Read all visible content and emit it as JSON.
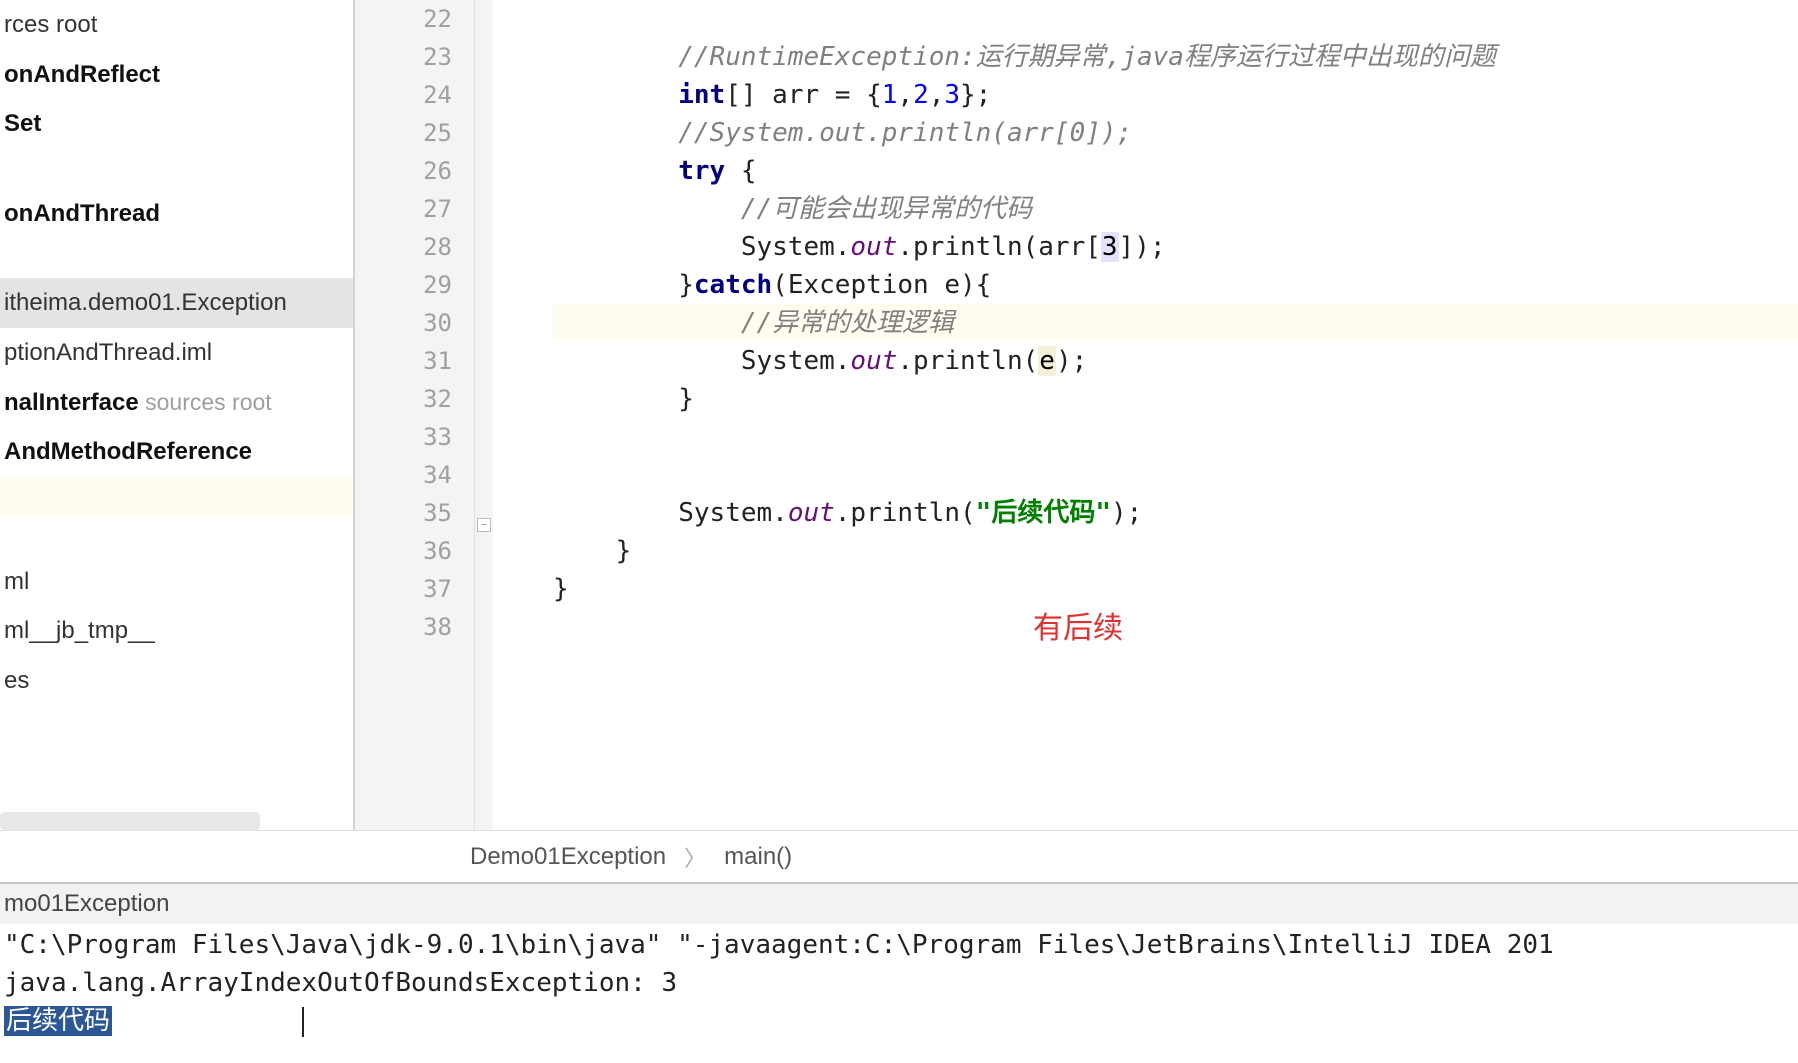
{
  "sidebar": {
    "items": [
      {
        "label": "rces root",
        "bold": false,
        "suffix": ""
      },
      {
        "label": "onAndReflect",
        "bold": true
      },
      {
        "label": "Set",
        "bold": true
      },
      {
        "label": "",
        "blank": true
      },
      {
        "label": "onAndThread",
        "bold": true
      },
      {
        "label": "",
        "blank": true
      },
      {
        "label": "itheima.demo01.Exception",
        "bold": false,
        "selected": true
      },
      {
        "label": "ptionAndThread.iml",
        "bold": false
      },
      {
        "label": "nalInterface",
        "bold": true,
        "suffix": "sources root"
      },
      {
        "label": "AndMethodReference",
        "bold": true
      },
      {
        "label": "",
        "blank": true,
        "highlight": true
      },
      {
        "label": "",
        "blank": true
      },
      {
        "label": "ml",
        "bold": false
      },
      {
        "label": "ml__jb_tmp__",
        "bold": false
      },
      {
        "label": "es",
        "bold": false
      }
    ]
  },
  "gutter": {
    "start": 22,
    "end": 38
  },
  "code": {
    "lines": [
      {
        "n": 22,
        "segments": []
      },
      {
        "n": 23,
        "indent": 2,
        "segments": [
          {
            "c": "kw-comment",
            "t": "//RuntimeException:运行期异常,java程序运行过程中出现的问题"
          }
        ]
      },
      {
        "n": 24,
        "indent": 2,
        "segments": [
          {
            "c": "kw-type",
            "t": "int"
          },
          {
            "c": "kw-plain",
            "t": "[] arr = {"
          },
          {
            "c": "kw-number",
            "t": "1"
          },
          {
            "c": "kw-plain",
            "t": ","
          },
          {
            "c": "kw-number",
            "t": "2"
          },
          {
            "c": "kw-plain",
            "t": ","
          },
          {
            "c": "kw-number",
            "t": "3"
          },
          {
            "c": "kw-plain",
            "t": "};"
          }
        ]
      },
      {
        "n": 25,
        "indent": 2,
        "segments": [
          {
            "c": "kw-comment",
            "t": "//System.out.println(arr[0]);"
          }
        ]
      },
      {
        "n": 26,
        "indent": 2,
        "segments": [
          {
            "c": "kw-keyword",
            "t": "try"
          },
          {
            "c": "kw-plain",
            "t": " {"
          }
        ]
      },
      {
        "n": 27,
        "indent": 3,
        "segments": [
          {
            "c": "kw-comment",
            "t": "//可能会出现异常的代码"
          }
        ]
      },
      {
        "n": 28,
        "indent": 3,
        "segments": [
          {
            "c": "kw-plain",
            "t": "System."
          },
          {
            "c": "kw-field",
            "t": "out"
          },
          {
            "c": "kw-plain",
            "t": ".println(arr["
          },
          {
            "c": "kw-index-hl",
            "t": "3"
          },
          {
            "c": "kw-plain",
            "t": "]);"
          }
        ]
      },
      {
        "n": 29,
        "indent": 2,
        "segments": [
          {
            "c": "kw-plain",
            "t": "}"
          },
          {
            "c": "kw-keyword",
            "t": "catch"
          },
          {
            "c": "kw-plain",
            "t": "(Exception e){"
          }
        ]
      },
      {
        "n": 30,
        "indent": 3,
        "hl": true,
        "segments": [
          {
            "c": "kw-comment",
            "t": "//异常的处理逻辑"
          }
        ]
      },
      {
        "n": 31,
        "indent": 3,
        "segments": [
          {
            "c": "kw-plain",
            "t": "System."
          },
          {
            "c": "kw-field",
            "t": "out"
          },
          {
            "c": "kw-plain",
            "t": ".println("
          },
          {
            "c": "kw-var-hl",
            "t": "e"
          },
          {
            "c": "kw-plain",
            "t": ");"
          }
        ]
      },
      {
        "n": 32,
        "indent": 2,
        "segments": [
          {
            "c": "kw-plain",
            "t": "}"
          }
        ]
      },
      {
        "n": 33,
        "segments": []
      },
      {
        "n": 34,
        "segments": []
      },
      {
        "n": 35,
        "indent": 2,
        "segments": [
          {
            "c": "kw-plain",
            "t": "System."
          },
          {
            "c": "kw-field",
            "t": "out"
          },
          {
            "c": "kw-plain",
            "t": ".println("
          },
          {
            "c": "kw-string",
            "t": "\"后续代码\""
          },
          {
            "c": "kw-plain",
            "t": ");"
          }
        ]
      },
      {
        "n": 36,
        "indent": 1,
        "segments": [
          {
            "c": "kw-plain",
            "t": "}"
          }
        ]
      },
      {
        "n": 37,
        "indent": 0,
        "segments": [
          {
            "c": "kw-plain",
            "t": "}"
          }
        ]
      },
      {
        "n": 38,
        "segments": []
      }
    ]
  },
  "annotation": "有后续",
  "breadcrumb": {
    "class": "Demo01Exception",
    "method": "main()"
  },
  "run": {
    "tab": "mo01Exception",
    "lines": [
      "\"C:\\Program Files\\Java\\jdk-9.0.1\\bin\\java\" \"-javaagent:C:\\Program Files\\JetBrains\\IntelliJ IDEA 201",
      "java.lang.ArrayIndexOutOfBoundsException: 3"
    ],
    "selected": "后续代码"
  }
}
